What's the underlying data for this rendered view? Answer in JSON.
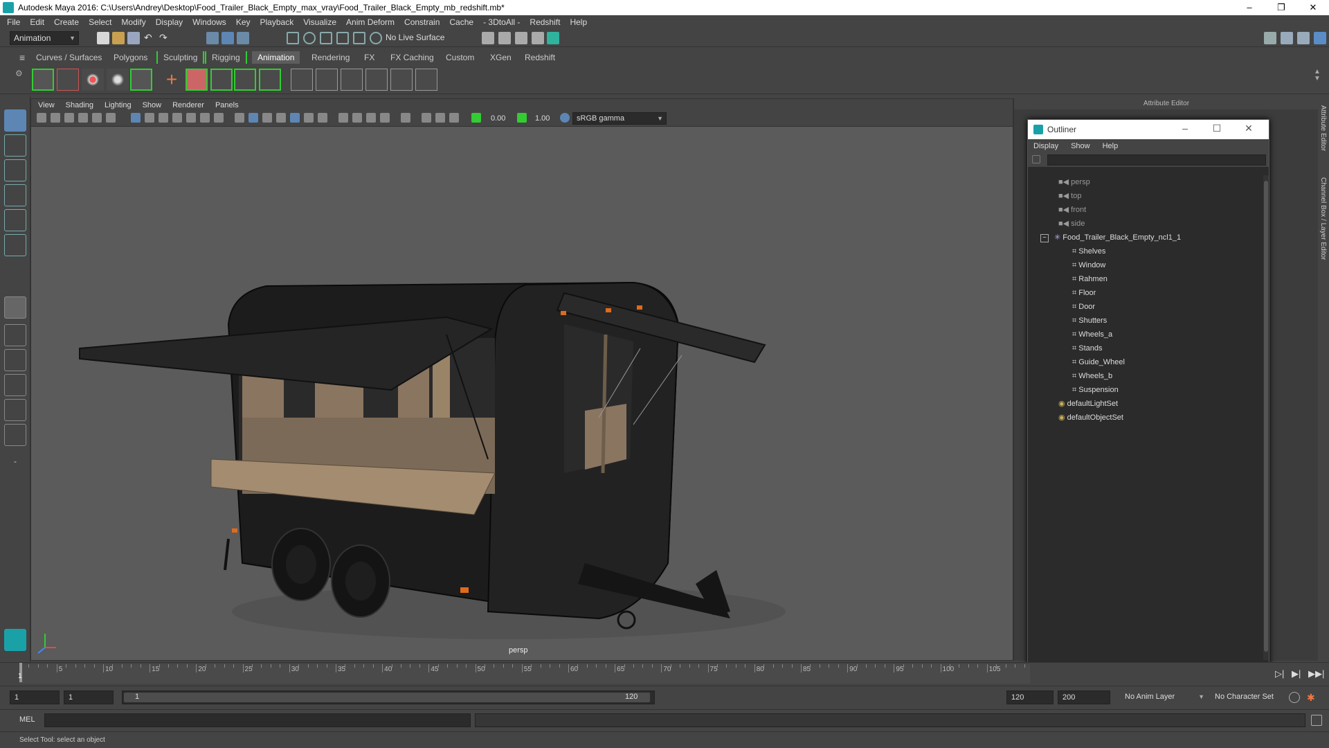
{
  "window": {
    "title": "Autodesk Maya 2016: C:\\Users\\Andrey\\Desktop\\Food_Trailer_Black_Empty_max_vray\\Food_Trailer_Black_Empty_mb_redshift.mb*",
    "minimize": "–",
    "maximize": "❐",
    "close": "✕"
  },
  "menubar": [
    "File",
    "Edit",
    "Create",
    "Select",
    "Modify",
    "Display",
    "Windows",
    "Key",
    "Playback",
    "Visualize",
    "Anim Deform",
    "Constrain",
    "Cache",
    "- 3DtoAll -",
    "Redshift",
    "Help"
  ],
  "statusline": {
    "menuset": "Animation",
    "live_surface": "No Live Surface"
  },
  "shelf_tabs": [
    "Curves / Surfaces",
    "Polygons",
    "Sculpting",
    "Rigging",
    "Animation",
    "Rendering",
    "FX",
    "FX Caching",
    "Custom",
    "XGen",
    "Redshift"
  ],
  "active_shelf_tab": "Animation",
  "viewport": {
    "menu": [
      "View",
      "Shading",
      "Lighting",
      "Show",
      "Renderer",
      "Panels"
    ],
    "exposure": "0.00",
    "gamma": "1.00",
    "colorspace": "sRGB gamma",
    "camera_label": "persp"
  },
  "attribute_editor": {
    "header": "Attribute Editor"
  },
  "side_tabs": [
    "Attribute Editor",
    "Channel Box / Layer Editor"
  ],
  "outliner": {
    "title": "Outliner",
    "menu": [
      "Display",
      "Show",
      "Help"
    ],
    "cameras": [
      "persp",
      "top",
      "front",
      "side"
    ],
    "group": "Food_Trailer_Black_Empty_ncl1_1",
    "children": [
      "Shelves",
      "Window",
      "Rahmen",
      "Floor",
      "Door",
      "Shutters",
      "Wheels_a",
      "Stands",
      "Guide_Wheel",
      "Wheels_b",
      "Suspension"
    ],
    "sets": [
      "defaultLightSet",
      "defaultObjectSet"
    ]
  },
  "timeslider": {
    "ticks": [
      "5",
      "10",
      "15",
      "20",
      "25",
      "30",
      "35",
      "40",
      "45",
      "50",
      "55",
      "60",
      "65",
      "70",
      "75",
      "80",
      "85",
      "90",
      "95",
      "100",
      "105"
    ],
    "current_frame": "1"
  },
  "range": {
    "start": "1",
    "current": "1",
    "range_start": "1",
    "range_end": "120",
    "end": "120",
    "anim_end": "200",
    "anim_layer": "No Anim Layer",
    "character_set": "No Character Set"
  },
  "cmdline": {
    "label": "MEL"
  },
  "helpline": "Select Tool: select an object",
  "colors": {
    "accent": "#5d5d5d",
    "brand": "#1aa1a8",
    "panel": "#444444",
    "viewport": "#5b5b5b"
  }
}
